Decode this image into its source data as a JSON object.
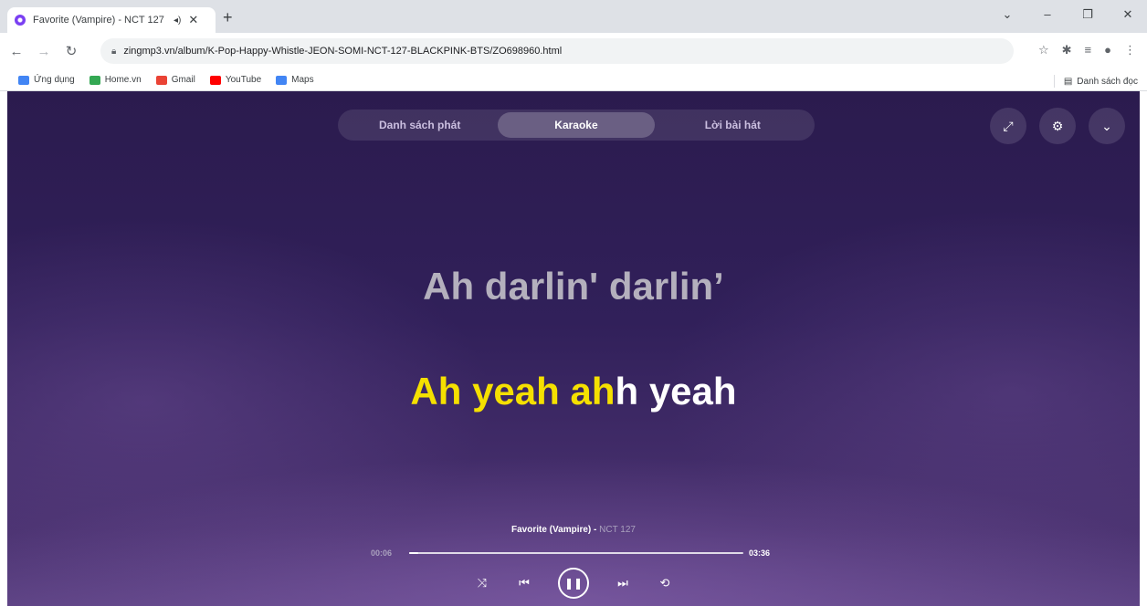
{
  "browser": {
    "tab_title": "Favorite (Vampire) - NCT 127",
    "tab_audio_icon": "speaker-icon",
    "url": "zingmp3.vn/album/K-Pop-Happy-Whistle-JEON-SOMI-NCT-127-BLACKPINK-BTS/ZO698960.html",
    "bookmarks": [
      {
        "label": "Ứng dụng",
        "color": "#ea4335"
      },
      {
        "label": "Home.vn",
        "color": "#34a853"
      },
      {
        "label": "Gmail",
        "color": "#ea4335"
      },
      {
        "label": "YouTube",
        "color": "#ff0000"
      },
      {
        "label": "Maps",
        "color": "#4285f4"
      }
    ],
    "reading_list": "Danh sách đọc"
  },
  "player": {
    "tabs": [
      "Danh sách phát",
      "Karaoke",
      "Lời bài hát"
    ],
    "active_tab": "Karaoke",
    "lyric_prev": "Ah darlin' darlin’",
    "lyric_current_sung": "Ah yeah ah",
    "lyric_current_rest": "h yeah",
    "song_title": "Favorite (Vampire)",
    "artist": "NCT 127",
    "time_current": "00:06",
    "time_total": "03:36",
    "progress_fraction": 0.028,
    "colors": {
      "highlight": "#f5e000",
      "background": "#2b1b4e"
    }
  }
}
